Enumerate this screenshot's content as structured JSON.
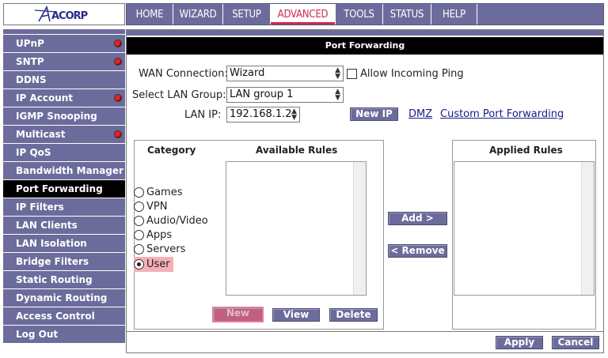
{
  "logo": {
    "text": "ACORP"
  },
  "nav": {
    "items": [
      {
        "label": "HOME"
      },
      {
        "label": "WIZARD"
      },
      {
        "label": "SETUP"
      },
      {
        "label": "ADVANCED"
      },
      {
        "label": "TOOLS"
      },
      {
        "label": "STATUS"
      },
      {
        "label": "HELP"
      }
    ],
    "active": "ADVANCED"
  },
  "sidebar": {
    "items": [
      {
        "label": "UPnP",
        "alert": true
      },
      {
        "label": "SNTP",
        "alert": true
      },
      {
        "label": "DDNS",
        "alert": false
      },
      {
        "label": "IP Account",
        "alert": true
      },
      {
        "label": "IGMP Snooping",
        "alert": false
      },
      {
        "label": "Multicast",
        "alert": true
      },
      {
        "label": "IP QoS",
        "alert": false
      },
      {
        "label": "Bandwidth Manager",
        "alert": false
      },
      {
        "label": "Port Forwarding",
        "alert": false
      },
      {
        "label": "IP Filters",
        "alert": false
      },
      {
        "label": "LAN Clients",
        "alert": false
      },
      {
        "label": "LAN Isolation",
        "alert": false
      },
      {
        "label": "Bridge Filters",
        "alert": false
      },
      {
        "label": "Static Routing",
        "alert": false
      },
      {
        "label": "Dynamic Routing",
        "alert": false
      },
      {
        "label": "Access Control",
        "alert": false
      },
      {
        "label": "Log Out",
        "alert": false
      }
    ],
    "active": "Port Forwarding"
  },
  "main": {
    "title": "Port Forwarding",
    "wan": {
      "label": "WAN Connection:",
      "value": "Wizard"
    },
    "allow_ping": {
      "label": "Allow Incoming Ping",
      "checked": false
    },
    "lan_group": {
      "label": "Select LAN Group:",
      "value": "LAN group 1"
    },
    "lan_ip": {
      "label": "LAN IP:",
      "value": "192.168.1.2"
    },
    "new_ip_button": "New IP",
    "dmz_link": "DMZ",
    "custom_link": "Custom Port Forwarding",
    "category": {
      "title": "Category",
      "options": [
        "Games",
        "VPN",
        "Audio/Video",
        "Apps",
        "Servers",
        "User"
      ],
      "selected": "User"
    },
    "available_title": "Available Rules",
    "applied_title": "Applied Rules",
    "add_button": "Add >",
    "remove_button": "< Remove",
    "new_button": "New",
    "view_button": "View",
    "delete_button": "Delete",
    "apply_button": "Apply",
    "cancel_button": "Cancel"
  },
  "colors": {
    "nav_bg": "#6c6c9c",
    "active_nav_text": "#cc2b4e",
    "alert_dot": "#e52222",
    "link": "#1a1a8a"
  }
}
